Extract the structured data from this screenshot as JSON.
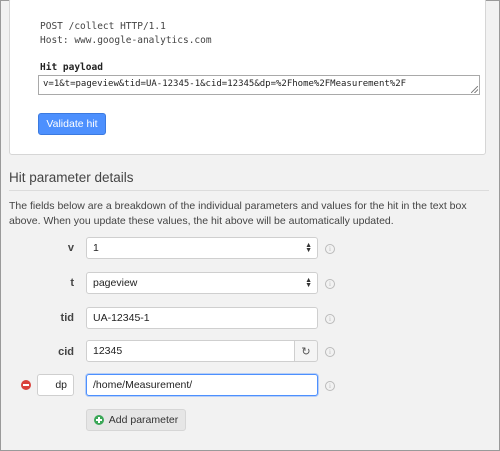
{
  "request": {
    "line1": "POST /collect HTTP/1.1",
    "line2": "Host: www.google-analytics.com"
  },
  "payload": {
    "label": "Hit payload",
    "value": "v=1&t=pageview&tid=UA-12345-1&cid=12345&dp=%2Fhome%2FMeasurement%2F"
  },
  "validate_label": "Validate hit",
  "details": {
    "title": "Hit parameter details",
    "description": "The fields below are a breakdown of the individual parameters and values for the hit in the text box above. When you update these values, the hit above will be automatically updated."
  },
  "params": [
    {
      "name": "v",
      "value": "1",
      "kind": "select"
    },
    {
      "name": "t",
      "value": "pageview",
      "kind": "select"
    },
    {
      "name": "tid",
      "value": "UA-12345-1",
      "kind": "text"
    },
    {
      "name": "cid",
      "value": "12345",
      "kind": "text-refresh"
    },
    {
      "name": "dp",
      "value": "/home/Measurement/",
      "kind": "custom"
    }
  ],
  "add_label": "Add parameter",
  "icons": {
    "info": "info-icon",
    "refresh": "refresh-icon",
    "remove": "remove-icon",
    "add": "plus-icon"
  },
  "colors": {
    "accent": "#4d90fe",
    "remove": "#d9413a",
    "add": "#3aa757"
  }
}
